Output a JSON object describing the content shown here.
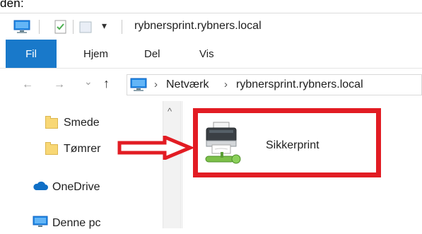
{
  "caption": {
    "text": "den:"
  },
  "title_bar": {
    "title": "rybnersprint.rybners.local",
    "qat_dropdown_glyph": "▾"
  },
  "ribbon": {
    "tabs": [
      {
        "label": "Fil",
        "active": true
      },
      {
        "label": "Hjem"
      },
      {
        "label": "Del"
      },
      {
        "label": "Vis"
      }
    ]
  },
  "address_bar": {
    "back_glyph": "←",
    "forward_glyph": "→",
    "recent_glyph": "⌄",
    "up_glyph": "↑",
    "breadcrumbs": [
      "Netværk",
      "rybnersprint.rybners.local"
    ],
    "separator": "›"
  },
  "navigation_pane": {
    "items": [
      {
        "label": "Smede",
        "icon": "folder-icon"
      },
      {
        "label": "Tømrer",
        "icon": "folder-icon"
      },
      {
        "label": "OneDrive",
        "icon": "onedrive-cloud-icon"
      },
      {
        "label": "Denne pc",
        "icon": "computer-icon"
      }
    ],
    "scroll_up_glyph": "^"
  },
  "content": {
    "items": [
      {
        "label": "Sikkerprint",
        "icon": "shared-printer-icon"
      }
    ]
  },
  "annotations": {
    "arrow_color": "#e21c23",
    "highlight_color": "#e21c23"
  },
  "colors": {
    "file_tab": "#1979ca",
    "folder": "#f8d775",
    "onedrive": "#0f6fc6",
    "monitor": "#1e88e5"
  }
}
